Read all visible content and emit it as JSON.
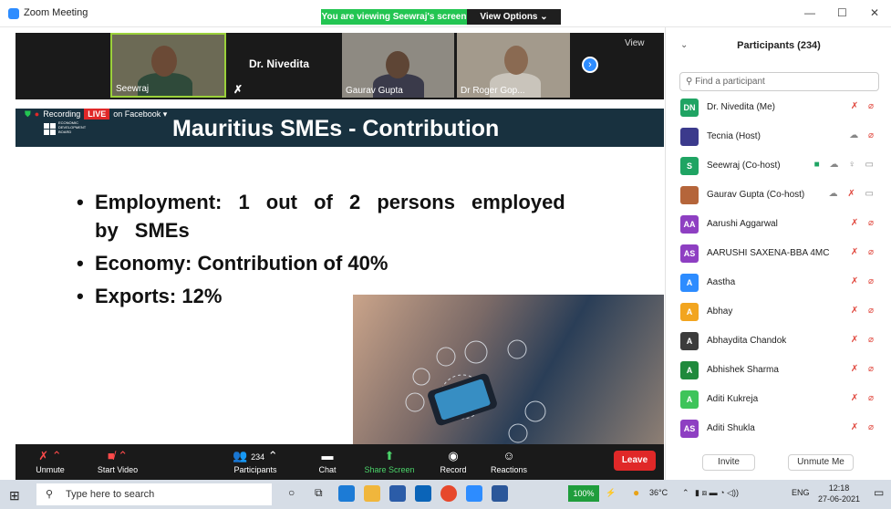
{
  "window": {
    "title": "Zoom Meeting",
    "share_banner": "You are viewing Seewraj's screen",
    "view_options": "View Options ⌄"
  },
  "videos": [
    {
      "name": "Seewraj"
    },
    {
      "name": "Dr. Nivedita"
    },
    {
      "name": "Gaurav Gupta"
    },
    {
      "name": "Dr Roger Gop..."
    }
  ],
  "view_button": "View",
  "recording": {
    "label": "Recording",
    "live": "LIVE",
    "live_target": "on Facebook ▾"
  },
  "slide": {
    "title": "Mauritius SMEs - Contribution",
    "logo_text": "ECONOMIC DEVELOPMENT BOARD",
    "bullets": [
      "Employment: 1 out of 2 persons employed by SMEs",
      "Economy: Contribution of 40%",
      "Exports: 12%"
    ]
  },
  "toolbar": {
    "unmute": "Unmute",
    "start_video": "Start Video",
    "participants": "Participants",
    "participants_count": "234",
    "chat": "Chat",
    "share_screen": "Share Screen",
    "record": "Record",
    "reactions": "Reactions",
    "leave": "Leave"
  },
  "participants_panel": {
    "title": "Participants (234)",
    "search_placeholder": "Find a participant",
    "invite": "Invite",
    "unmute_me": "Unmute Me",
    "people": [
      {
        "initials": "DN",
        "name": "Dr. Nivedita (Me)",
        "color": "#1fa463"
      },
      {
        "initials": "",
        "name": "Tecnia (Host)",
        "color": "#3b3a8c"
      },
      {
        "initials": "S",
        "name": "Seewraj (Co-host)",
        "color": "#1fa463"
      },
      {
        "initials": "",
        "name": "Gaurav Gupta (Co-host)",
        "color": "#b5653a"
      },
      {
        "initials": "AA",
        "name": "Aarushi Aggarwal",
        "color": "#8e3fc2"
      },
      {
        "initials": "AS",
        "name": "AARUSHI SAXENA-BBA 4MC",
        "color": "#8e3fc2"
      },
      {
        "initials": "A",
        "name": "Aastha",
        "color": "#2d8cff"
      },
      {
        "initials": "A",
        "name": "Abhay",
        "color": "#f2a51f"
      },
      {
        "initials": "A",
        "name": "Abhaydita Chandok",
        "color": "#3c3c3c"
      },
      {
        "initials": "A",
        "name": "Abhishek Sharma",
        "color": "#1f8a3c"
      },
      {
        "initials": "A",
        "name": "Aditi Kukreja",
        "color": "#3ec45a"
      },
      {
        "initials": "AS",
        "name": "Aditi Shukla",
        "color": "#8e3fc2"
      }
    ]
  },
  "taskbar": {
    "search_placeholder": "Type here to search",
    "battery": "100%",
    "temperature": "36°C",
    "language": "ENG",
    "time": "12:18",
    "date": "27-06-2021"
  }
}
